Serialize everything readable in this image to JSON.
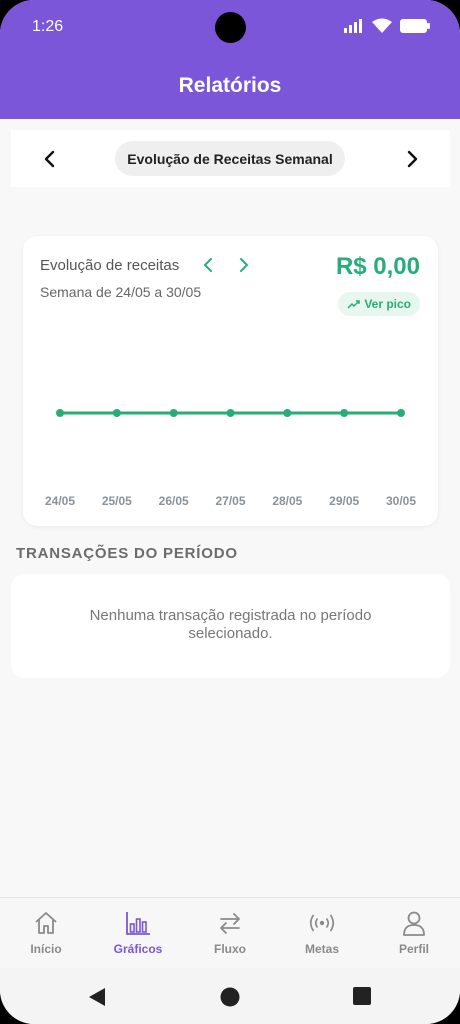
{
  "status_bar": {
    "time": "1:26"
  },
  "header": {
    "title": "Relatórios"
  },
  "selector": {
    "label": "Evolução de Receitas Semanal"
  },
  "chart_card": {
    "title": "Evolução de receitas",
    "period": "Semana de 24/05 a 30/05",
    "amount": "R$ 0,00",
    "peak_label": "Ver pico",
    "accent_color": "#27ad7a"
  },
  "chart_data": {
    "type": "line",
    "categories": [
      "24/05",
      "25/05",
      "26/05",
      "27/05",
      "28/05",
      "29/05",
      "30/05"
    ],
    "series": [
      {
        "values": [
          0,
          0,
          0,
          0,
          0,
          0,
          0
        ]
      }
    ],
    "title": "",
    "xlabel": "",
    "ylabel": "",
    "grid": false
  },
  "transactions": {
    "section_title": "TRANSAÇÕES DO PERÍODO",
    "empty_message": "Nenhuma transação registrada no período selecionado."
  },
  "bottom_nav": {
    "items": [
      {
        "label": "Início",
        "icon": "home-icon"
      },
      {
        "label": "Gráficos",
        "icon": "bar-chart-icon",
        "active": true
      },
      {
        "label": "Fluxo",
        "icon": "swap-arrows-icon"
      },
      {
        "label": "Metas",
        "icon": "broadcast-icon"
      },
      {
        "label": "Perfil",
        "icon": "user-icon"
      }
    ]
  },
  "colors": {
    "primary": "#7b56d9",
    "success": "#27ad7a"
  }
}
